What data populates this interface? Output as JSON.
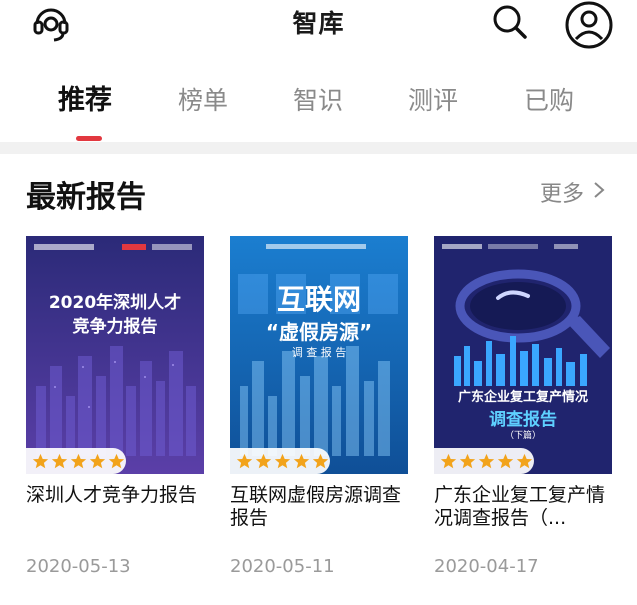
{
  "header": {
    "title": "智库"
  },
  "tabs": [
    {
      "label": "推荐",
      "active": true
    },
    {
      "label": "榜单"
    },
    {
      "label": "智识"
    },
    {
      "label": "测评"
    },
    {
      "label": "已购"
    }
  ],
  "section": {
    "title": "最新报告",
    "more_label": "更多"
  },
  "reports": [
    {
      "title": "深圳人才竞争力报告",
      "date": "2020-05-13",
      "rating": 5,
      "cover_line1": "2020年深圳人才",
      "cover_line2": "竞争力报告",
      "cover_color": "#2a2a7a"
    },
    {
      "title": "互联网虚假房源调查报告",
      "date": "2020-05-11",
      "rating": 5,
      "cover_line1": "互联网",
      "cover_line2": "“虚假房源”",
      "cover_line3": "调 查 报 告",
      "cover_color": "#1a6fc2"
    },
    {
      "title": "广东企业复工复产情况调查报告（...",
      "date": "2020-04-17",
      "rating": 5,
      "cover_line1": "广东企业复工复产情况",
      "cover_line2": "调查报告",
      "cover_line3": "（下篇）",
      "cover_color": "#20246e"
    }
  ],
  "colors": {
    "accent": "#e2383f",
    "star": "#f2a31b"
  },
  "icons": [
    "headset-icon",
    "search-icon",
    "user-icon",
    "chevron-right-icon",
    "star-icon"
  ]
}
